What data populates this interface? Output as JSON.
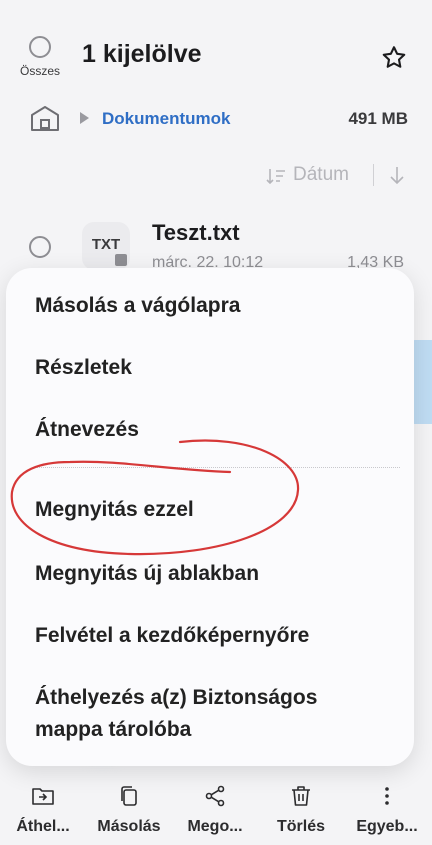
{
  "header": {
    "select_all_label": "Összes",
    "title": "1 kijelölve"
  },
  "breadcrumb": {
    "folder": "Dokumentumok",
    "size": "491 MB"
  },
  "sort": {
    "label": "Dátum"
  },
  "file": {
    "icon_text": "TXT",
    "name": "Teszt.txt",
    "date": "márc. 22. 10:12",
    "size": "1,43 KB"
  },
  "context_menu": {
    "items": [
      "Másolás a vágólapra",
      "Részletek",
      "Átnevezés",
      "Megnyitás ezzel",
      "Megnyitás új ablakban",
      "Felvétel a kezdőképernyőre",
      "Áthelyezés a(z) Biztonságos",
      "mappa tárolóba"
    ]
  },
  "bottom_bar": {
    "items": [
      "Áthel...",
      "Másolás",
      "Mego...",
      "Törlés",
      "Egyeb..."
    ]
  },
  "colors": {
    "accent_link": "#2f6ec5",
    "annotation": "#d63838"
  }
}
